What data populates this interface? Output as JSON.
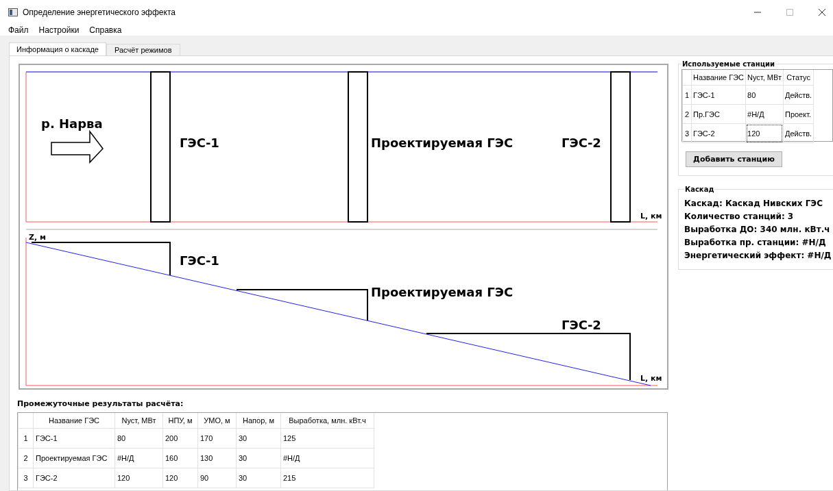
{
  "window": {
    "title": "Определение энергетического эффекта"
  },
  "menu": [
    "Файл",
    "Настройки",
    "Справка"
  ],
  "tabs": [
    {
      "label": "Информация о каскаде",
      "selected": true
    },
    {
      "label": "Расчёт режимов",
      "selected": false
    }
  ],
  "diagram": {
    "river_label": "р. Нарва",
    "plan_stations": [
      "ГЭС-1",
      "Проектируемая ГЭС",
      "ГЭС-2"
    ],
    "plan_axis": "L, км",
    "profile_axis_z": "Z, м",
    "profile_stations": [
      "ГЭС-1",
      "Проектируемая ГЭС",
      "ГЭС-2"
    ],
    "profile_axis_l": "L, км"
  },
  "stations_group": {
    "title": "Используемые станции",
    "columns": [
      "Название ГЭС",
      "Nуст, МВт",
      "Статус"
    ],
    "rows": [
      {
        "index": "1",
        "name": "ГЭС-1",
        "power": "80",
        "status": "Действ.",
        "power_focused": false
      },
      {
        "index": "2",
        "name": "Пр.ГЭС",
        "power": "#Н/Д",
        "status": "Проект.",
        "power_focused": false
      },
      {
        "index": "3",
        "name": "ГЭС-2",
        "power": "120",
        "status": "Действ.",
        "power_focused": true
      }
    ],
    "add_button": "Добавить станцию"
  },
  "cascade_group": {
    "title": "Каскад",
    "lines": [
      "Каскад: Каскад Нивских ГЭС",
      "Количество станций: 3",
      "Выработка ДО: 340 млн. кВт.ч",
      "Выработка пр. станции: #Н/Д",
      "Энергетический эффект: #Н/Д"
    ]
  },
  "results": {
    "title": "Промежуточные результаты расчёта:",
    "columns": [
      "Название ГЭС",
      "Nуст, МВт",
      "НПУ, м",
      "УМО, м",
      "Напор, м",
      "Выработка, млн. кВт.ч"
    ],
    "rows": [
      {
        "index": "1",
        "cells": [
          "ГЭС-1",
          "80",
          "200",
          "170",
          "30",
          "125"
        ]
      },
      {
        "index": "2",
        "cells": [
          "Проектируемая ГЭС",
          "#Н/Д",
          "160",
          "130",
          "30",
          "#Н/Д"
        ]
      },
      {
        "index": "3",
        "cells": [
          "ГЭС-2",
          "120",
          "120",
          "90",
          "30",
          "215"
        ]
      }
    ]
  }
}
